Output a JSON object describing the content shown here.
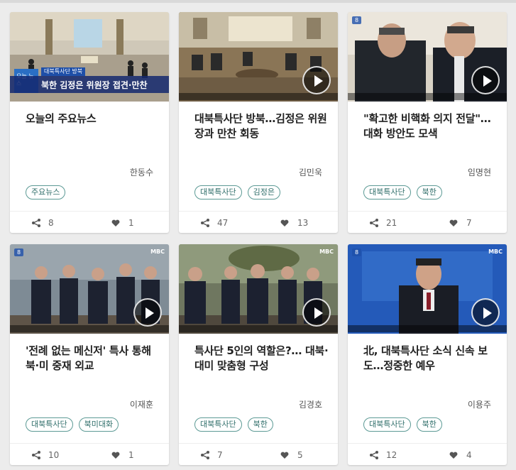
{
  "cards": [
    {
      "title": "오늘의 주요뉴스",
      "author": "한동수",
      "tags": [
        "주요뉴스"
      ],
      "shares": "8",
      "likes": "1",
      "thumb_caption": "북한 김정은 위원장 접견·만찬",
      "thumb_sub": "대북특사단 방북",
      "thumb_logo": "오늘 뉴스"
    },
    {
      "title": "대북특사단 방북…김정은 위원장과 만찬 회동",
      "author": "김민욱",
      "tags": [
        "대북특사단",
        "김정은"
      ],
      "shares": "47",
      "likes": "13"
    },
    {
      "title": "\"확고한 비핵화 의지 전달\"…대화 방안도 모색",
      "author": "임명현",
      "tags": [
        "대북특사단",
        "북한"
      ],
      "shares": "21",
      "likes": "7"
    },
    {
      "title": "'전례 없는 메신저' 특사 통해 북·미 중재 외교",
      "author": "이재훈",
      "tags": [
        "대북특사단",
        "북미대화"
      ],
      "shares": "10",
      "likes": "1"
    },
    {
      "title": "특사단 5인의 역할은?… 대북·대미 맞춤형 구성",
      "author": "김경호",
      "tags": [
        "대북특사단",
        "북한"
      ],
      "shares": "7",
      "likes": "5"
    },
    {
      "title": "北, 대북특사단 소식 신속 보도…정중한 예우",
      "author": "이용주",
      "tags": [
        "대북특사단",
        "북한"
      ],
      "shares": "12",
      "likes": "4"
    }
  ],
  "colors": {
    "tag_border": "#5c9a95",
    "tag_text": "#2f6e6a"
  }
}
